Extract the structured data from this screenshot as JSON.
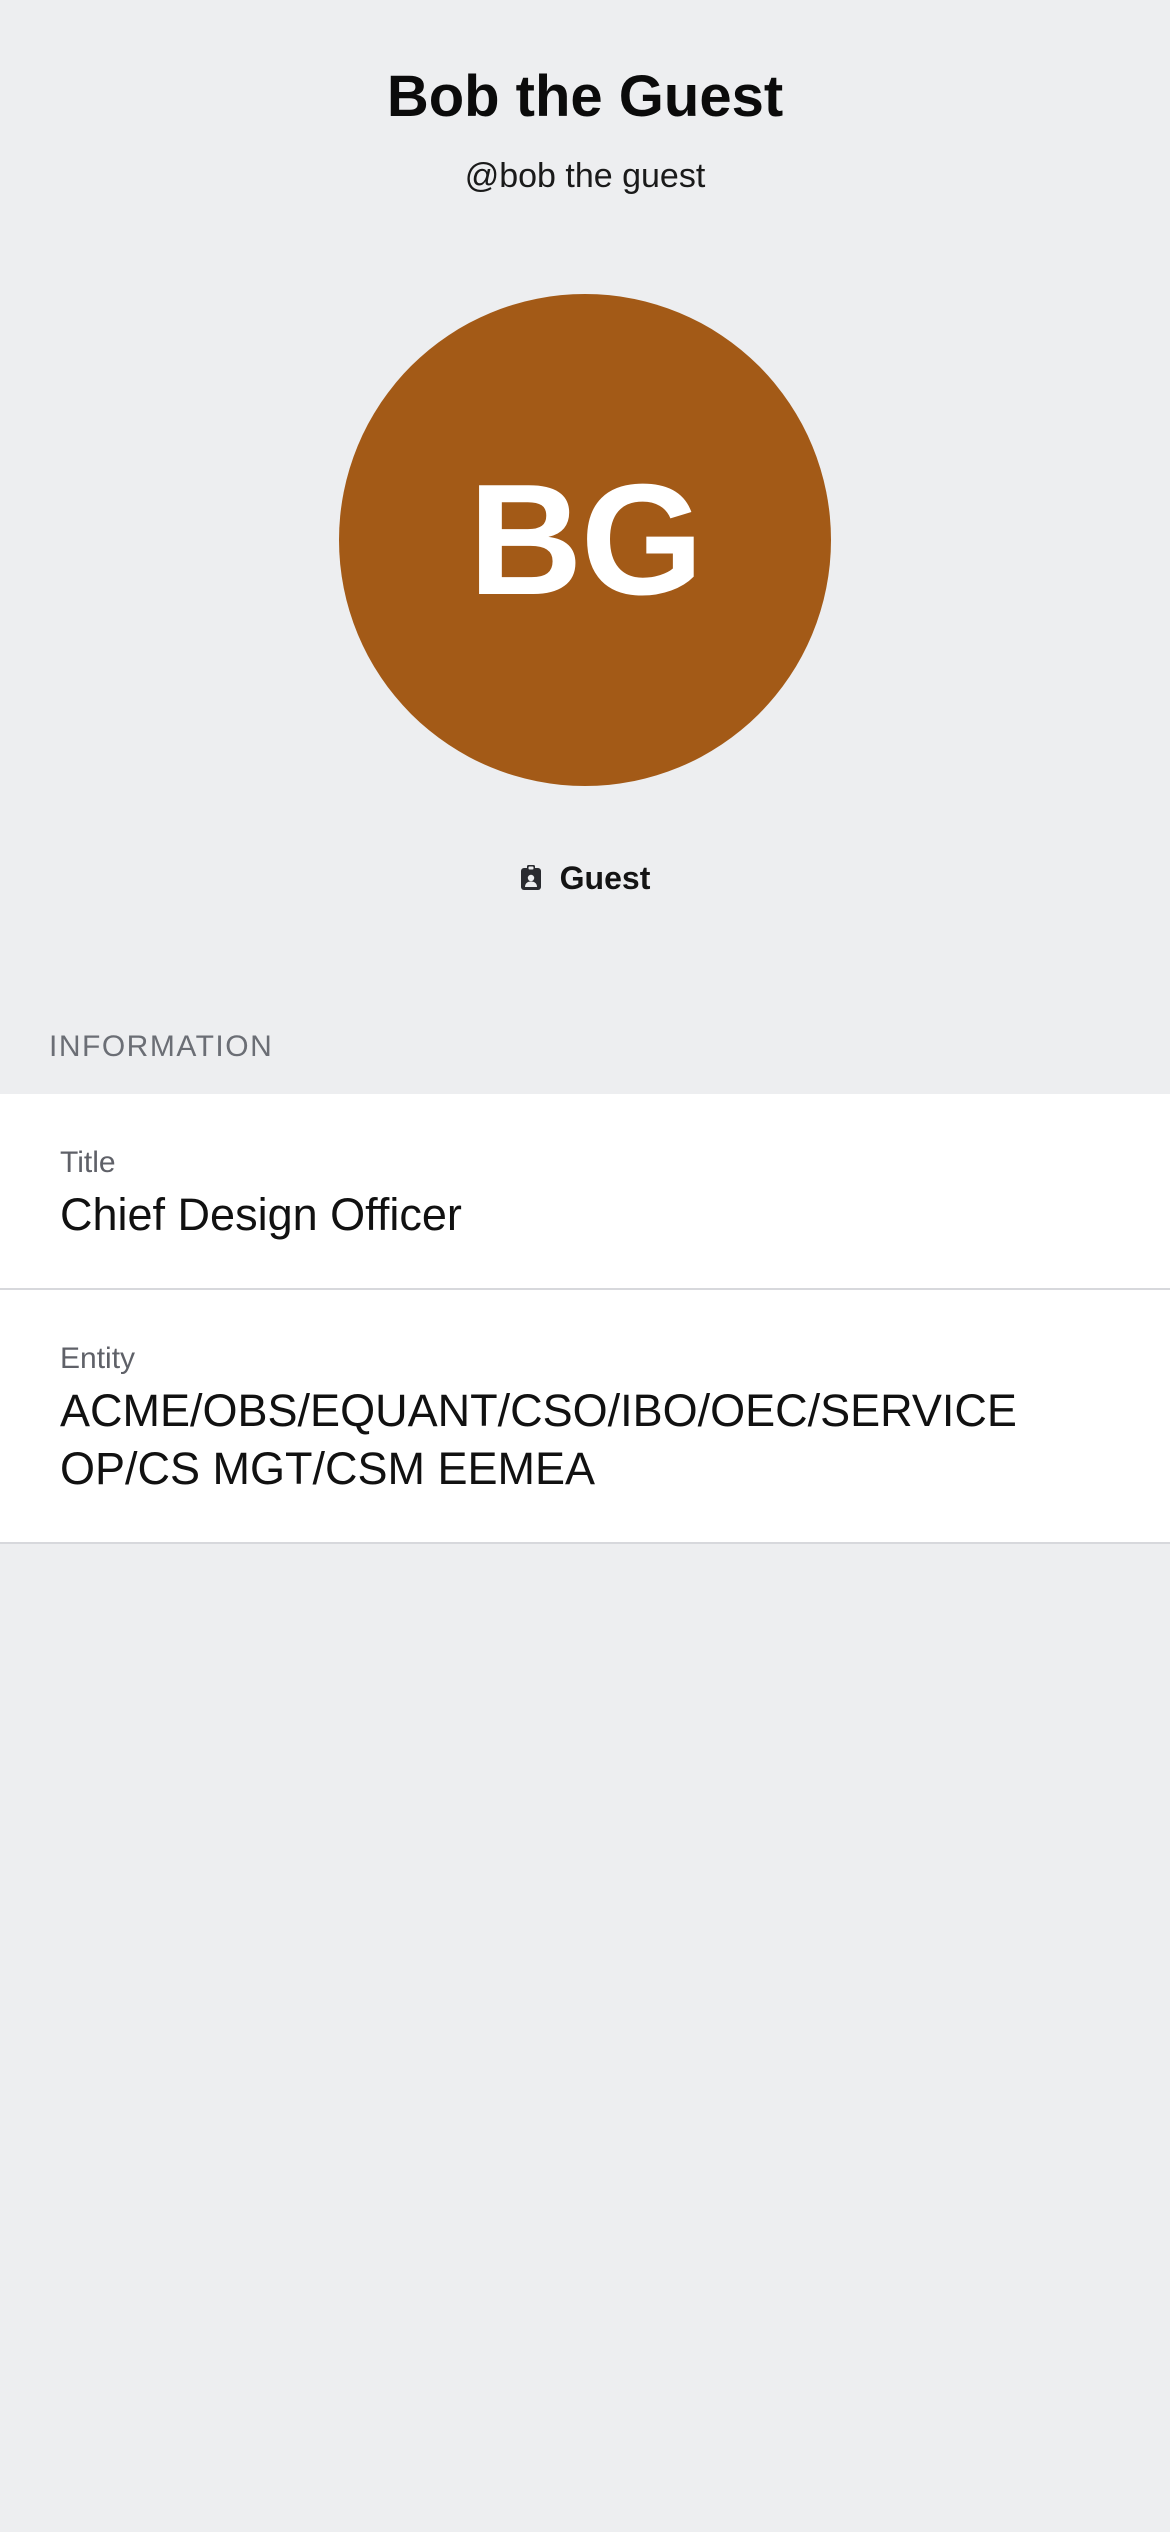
{
  "profile": {
    "display_name": "Bob the Guest",
    "username": "@bob the guest",
    "avatar_initials": "BG",
    "avatar_color": "#a35a17",
    "role_icon": "badge-icon",
    "role_label": "Guest"
  },
  "information": {
    "section_title": "INFORMATION",
    "rows": [
      {
        "label": "Title",
        "value": "Chief Design Officer"
      },
      {
        "label": "Entity",
        "value": "ACME/OBS/EQUANT/CSO/IBO/OEC/SERVICE OP/CS MGT/CSM EEMEA"
      }
    ]
  }
}
